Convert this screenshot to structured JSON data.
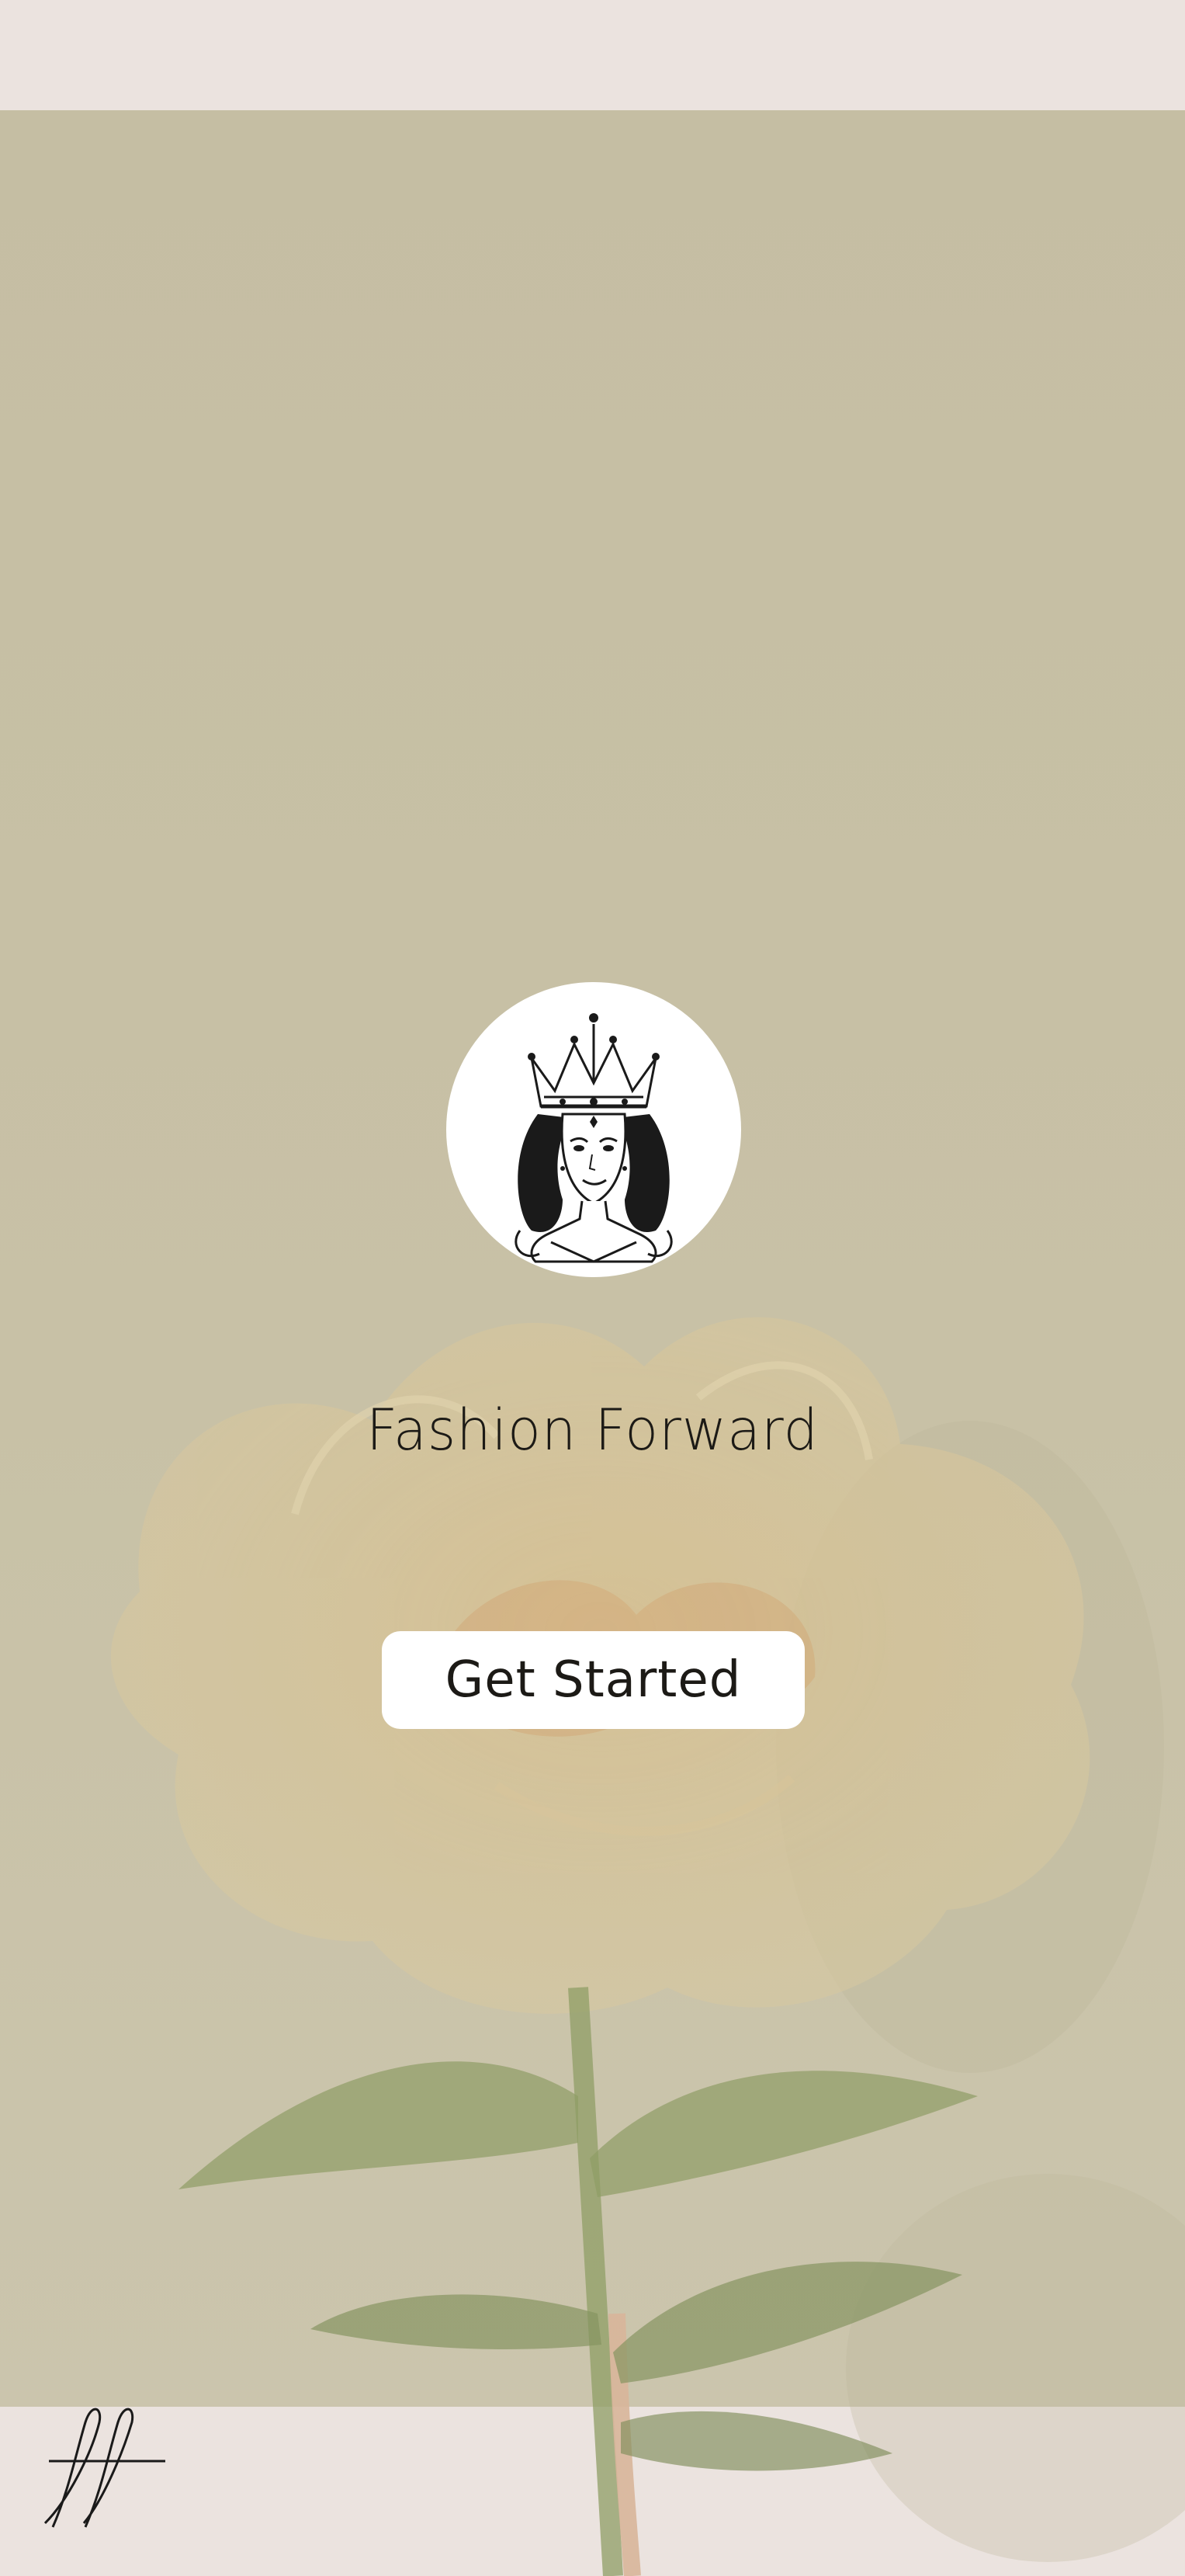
{
  "app": {
    "brand_title": "Fashion Forward",
    "cta_label": "Get Started",
    "monogram": "ff"
  },
  "icons": {
    "logo": "crowned-queen-logo-icon",
    "monogram": "ff-monogram-icon"
  },
  "colors": {
    "stage_background": "#c6bfa4",
    "page_background": "#ebe3df",
    "button_background": "#ffffff",
    "text": "#1c1a16"
  }
}
